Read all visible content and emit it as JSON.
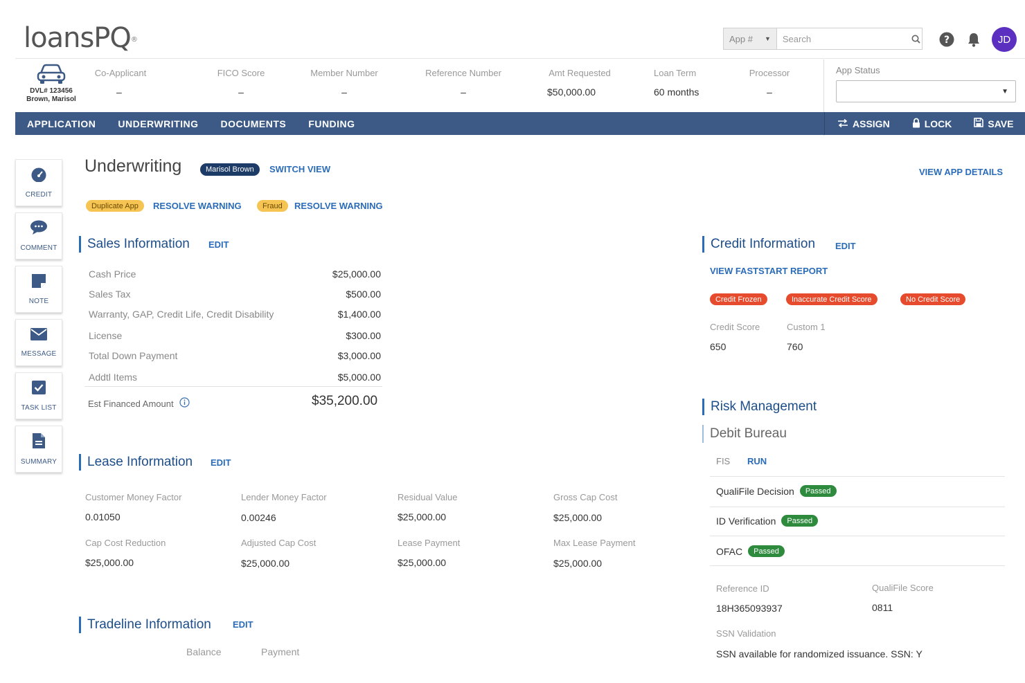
{
  "header": {
    "logo": "loansPQ",
    "logo_mark": "®",
    "app_select": "App #",
    "search_placeholder": "Search",
    "avatar": "JD"
  },
  "summary": {
    "vehicle_dl": "DVL# 123456",
    "vehicle_name": "Brown, Marisol",
    "fields": [
      {
        "label": "Co-Applicant",
        "value": "–"
      },
      {
        "label": "FICO Score",
        "value": "–"
      },
      {
        "label": "Member Number",
        "value": "–"
      },
      {
        "label": "Reference Number",
        "value": "–"
      },
      {
        "label": "Amt Requested",
        "value": "$50,000.00"
      },
      {
        "label": "Loan Term",
        "value": "60 months"
      },
      {
        "label": "Processor",
        "value": "–"
      }
    ],
    "app_status_label": "App Status"
  },
  "nav": {
    "tabs": [
      "APPLICATION",
      "UNDERWRITING",
      "DOCUMENTS",
      "FUNDING"
    ],
    "actions": [
      "ASSIGN",
      "LOCK",
      "SAVE"
    ]
  },
  "rail": [
    "CREDIT",
    "COMMENT",
    "NOTE",
    "MESSAGE",
    "TASK LIST",
    "SUMMARY"
  ],
  "page": {
    "title": "Underwriting",
    "applicant_pill": "Marisol Brown",
    "switch_view": "SWITCH VIEW",
    "view_app_details": "VIEW APP DETAILS",
    "warnings": [
      {
        "tag": "Duplicate App",
        "action": "RESOLVE WARNING"
      },
      {
        "tag": "Fraud",
        "action": "RESOLVE WARNING"
      }
    ]
  },
  "sales": {
    "title": "Sales Information",
    "edit": "EDIT",
    "rows": [
      {
        "label": "Cash Price",
        "value": "$25,000.00"
      },
      {
        "label": "Sales Tax",
        "value": "$500.00"
      },
      {
        "label": "Warranty, GAP, Credit Life, Credit Disability",
        "value": "$1,400.00"
      },
      {
        "label": "License",
        "value": "$300.00"
      },
      {
        "label": "Total Down Payment",
        "value": "$3,000.00"
      },
      {
        "label": "Addtl Items",
        "value": "$5,000.00"
      }
    ],
    "est_label": "Est Financed Amount",
    "est_value": "$35,200.00"
  },
  "lease": {
    "title": "Lease Information",
    "edit": "EDIT",
    "fields": [
      {
        "label": "Customer Money Factor",
        "value": "0.01050"
      },
      {
        "label": "Lender Money Factor",
        "value": "0.00246"
      },
      {
        "label": "Residual Value",
        "value": "$25,000.00"
      },
      {
        "label": "Gross Cap Cost",
        "value": "$25,000.00"
      },
      {
        "label": "Cap Cost Reduction",
        "value": "$25,000.00"
      },
      {
        "label": "Adjusted Cap Cost",
        "value": "$25,000.00"
      },
      {
        "label": "Lease Payment",
        "value": "$25,000.00"
      },
      {
        "label": "Max Lease Payment",
        "value": "$25,000.00"
      }
    ]
  },
  "tradeline": {
    "title": "Tradeline Information",
    "edit": "EDIT",
    "columns": [
      "Balance",
      "Payment"
    ]
  },
  "credit": {
    "title": "Credit Information",
    "edit": "EDIT",
    "report_link": "VIEW FASTSTART REPORT",
    "flags": [
      "Credit Frozen",
      "Inaccurate Credit Score",
      "No Credit Score"
    ],
    "scores": [
      {
        "label": "Credit Score",
        "value": "650"
      },
      {
        "label": "Custom 1",
        "value": "760"
      }
    ]
  },
  "risk": {
    "title": "Risk Management",
    "subtitle": "Debit Bureau",
    "fis_label": "FIS",
    "run": "RUN",
    "checks": [
      {
        "label": "QualiFile Decision",
        "status": "Passed"
      },
      {
        "label": "ID Verification",
        "status": "Passed"
      },
      {
        "label": "OFAC",
        "status": "Passed"
      }
    ],
    "reference_id_label": "Reference ID",
    "reference_id": "18H365093937",
    "qualifile_score_label": "QualiFile Score",
    "qualifile_score": "0811",
    "ssn_label": "SSN Validation",
    "ssn_value": "SSN available for randomized issuance. SSN: Y"
  },
  "colors": {
    "nav_bg": "#3c5a85",
    "link": "#2b6cb8",
    "heading": "#1d4e89",
    "warning": "#f6c453",
    "danger": "#e54b2c",
    "success": "#2e8b3e",
    "avatar": "#5b2fbf"
  },
  "icons": [
    "search-icon",
    "help-icon",
    "bell-icon",
    "car-icon",
    "assign-icon",
    "lock-icon",
    "save-icon",
    "credit-gauge-icon",
    "comment-icon",
    "note-icon",
    "message-icon",
    "task-check-icon",
    "summary-doc-icon",
    "info-icon",
    "chevron-down-icon"
  ]
}
